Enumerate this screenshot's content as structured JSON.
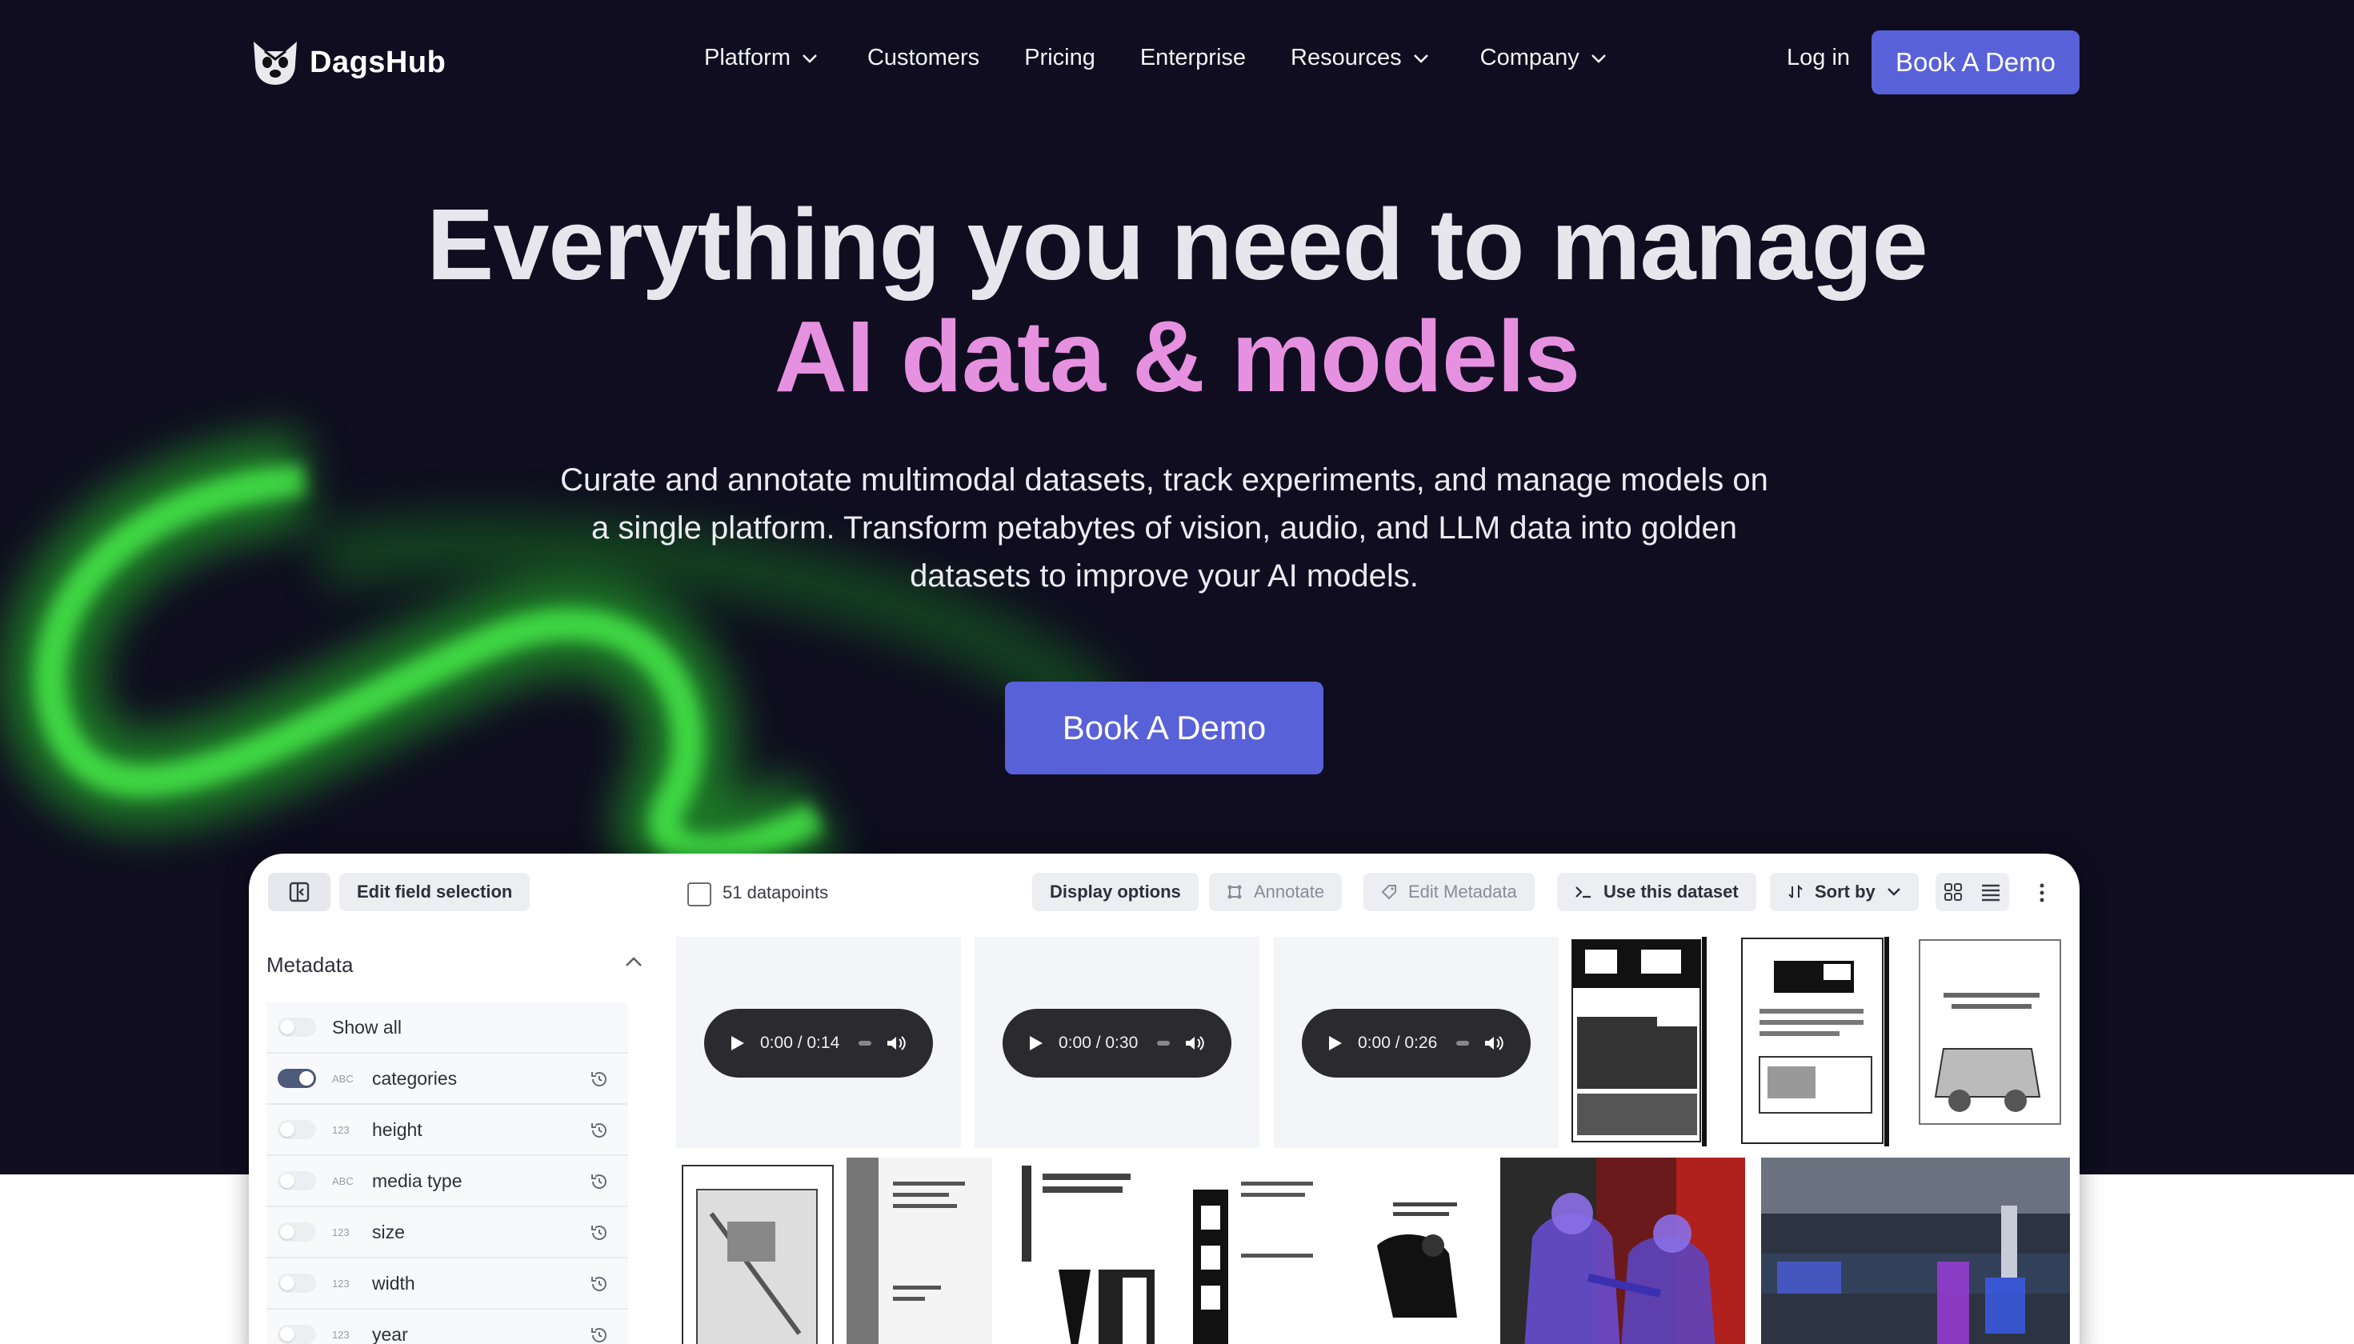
{
  "brand": {
    "name": "DagsHub",
    "logo_icon": "dog-logo-icon"
  },
  "nav": {
    "links": [
      {
        "label": "Platform",
        "has_dropdown": true
      },
      {
        "label": "Customers",
        "has_dropdown": false
      },
      {
        "label": "Pricing",
        "has_dropdown": false
      },
      {
        "label": "Enterprise",
        "has_dropdown": false
      },
      {
        "label": "Resources",
        "has_dropdown": true
      },
      {
        "label": "Company",
        "has_dropdown": true
      }
    ],
    "login_label": "Log in",
    "cta_label": "Book A Demo"
  },
  "hero": {
    "headline_line1": "Everything you need to manage",
    "headline_line2": "AI data & models",
    "subtitle": "Curate and annotate multimodal datasets, track experiments, and manage models on a single platform. Transform petabytes of vision, audio, and LLM data into golden datasets to improve your AI models.",
    "cta_label": "Book A Demo"
  },
  "app": {
    "toolbar": {
      "edit_fields_label": "Edit field selection",
      "datapoints_label": "51 datapoints",
      "display_options_label": "Display options",
      "annotate_label": "Annotate",
      "edit_metadata_label": "Edit Metadata",
      "use_dataset_label": "Use this dataset",
      "sort_label": "Sort by"
    },
    "metadata": {
      "title": "Metadata",
      "fields": [
        {
          "type": "",
          "name": "Show all",
          "enabled": false,
          "history": false
        },
        {
          "type": "ABC",
          "name": "categories",
          "enabled": true,
          "history": true
        },
        {
          "type": "123",
          "name": "height",
          "enabled": false,
          "history": true
        },
        {
          "type": "ABC",
          "name": "media type",
          "enabled": false,
          "history": true
        },
        {
          "type": "123",
          "name": "size",
          "enabled": false,
          "history": true
        },
        {
          "type": "123",
          "name": "width",
          "enabled": false,
          "history": true
        },
        {
          "type": "123",
          "name": "year",
          "enabled": false,
          "history": true
        }
      ]
    },
    "audio_clips": [
      {
        "time": "0:00 / 0:14"
      },
      {
        "time": "0:00 / 0:30"
      },
      {
        "time": "0:00 / 0:26"
      }
    ]
  },
  "colors": {
    "hero_bg": "#0f0d1f",
    "accent": "#5861d8",
    "headline_pink": "#e690e0",
    "glow_green": "#39ff3c"
  }
}
